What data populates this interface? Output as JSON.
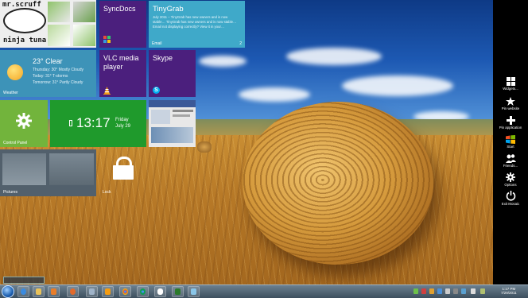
{
  "tiles": {
    "mrscruff": {
      "line1": "mr.scruff",
      "line2": "ninja tuna"
    },
    "syncdocs": {
      "label": "SyncDocs"
    },
    "tinygrab": {
      "title": "TinyGrab",
      "body": "July 2011 – TinyGrab has new owners and is now stable… TinyGrab has new owners and is now stable… Email not displaying correctly? View it in your…",
      "caption": "Email",
      "count": "2"
    },
    "weather": {
      "temp": "23° Clear",
      "line1": "Thursday: 30° Mostly Cloudy",
      "line2": "Today: 31° T-storms",
      "line3": "Tomorrow: 31° Partly Cloudy",
      "caption": "Weather"
    },
    "vlc": {
      "label": "VLC media player"
    },
    "skype": {
      "label": "Skype"
    },
    "control_panel": {
      "caption": "Control Panel"
    },
    "clock": {
      "time": "13:17",
      "day": "Friday",
      "date": "July 29"
    },
    "pictures": {
      "caption": "Pictures"
    },
    "lock": {
      "caption": "Lock"
    }
  },
  "charms": [
    {
      "label": "Widgets...",
      "icon": "widgets-icon"
    },
    {
      "label": "Pin website",
      "icon": "pin-icon"
    },
    {
      "label": "Pin application",
      "icon": "plus-icon"
    },
    {
      "label": "Start",
      "icon": "windows-flag-icon"
    },
    {
      "label": "Friends...",
      "icon": "friends-icon"
    },
    {
      "label": "Options",
      "icon": "gear-icon"
    },
    {
      "label": "Exit Mosaic",
      "icon": "power-icon"
    }
  ],
  "taskbar": {
    "clock_time": "1:17 PM",
    "clock_date": "7/29/2011",
    "apps": [
      "ie-icon",
      "explorer-icon",
      "firefox-icon",
      "windows-icon",
      "vlc-icon",
      "chrome-icon",
      "chrome-alt-icon",
      "chat-icon",
      "terminal-icon",
      "remote-icon"
    ]
  },
  "colors": {
    "purple_tile": "#4b1f7d",
    "blue_tile": "#3fa9c9",
    "green_tile": "#1f9a2c",
    "charms_bg": "#000000"
  }
}
